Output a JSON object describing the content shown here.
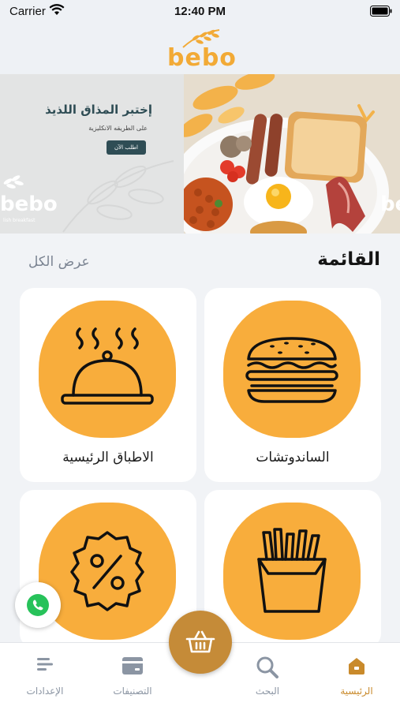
{
  "status_bar": {
    "carrier": "Carrier",
    "time": "12:40 PM"
  },
  "header": {
    "logo_text": "bebo"
  },
  "banner": {
    "title": "إختبر المذاق اللذيذ",
    "subtitle": "على الطريقه الانكليزية",
    "cta": "اطلب الآن",
    "brand": "bebo",
    "brand_tag": "lish breakfast",
    "brand_right": "be"
  },
  "menu_section": {
    "title": "القائمة",
    "view_all": "عرض الكل"
  },
  "categories": [
    {
      "label": "الساندوتشات",
      "icon": "sandwich-icon"
    },
    {
      "label": "الاطباق الرئيسية",
      "icon": "serving-dish-icon"
    },
    {
      "label": "",
      "icon": "fries-icon"
    },
    {
      "label": "",
      "icon": "discount-icon"
    }
  ],
  "tabs": [
    {
      "label": "الرئيسية",
      "icon": "home-icon",
      "active": true
    },
    {
      "label": "البحث",
      "icon": "search-icon",
      "active": false
    },
    {
      "label": "التصنيفات",
      "icon": "card-icon",
      "active": false
    },
    {
      "label": "الإعدادات",
      "icon": "settings-lines-icon",
      "active": false
    }
  ],
  "colors": {
    "accent": "#f8ad3c",
    "brand_dark": "#c58b38",
    "active_tab": "#c98a2b",
    "whatsapp": "#27c25a"
  }
}
